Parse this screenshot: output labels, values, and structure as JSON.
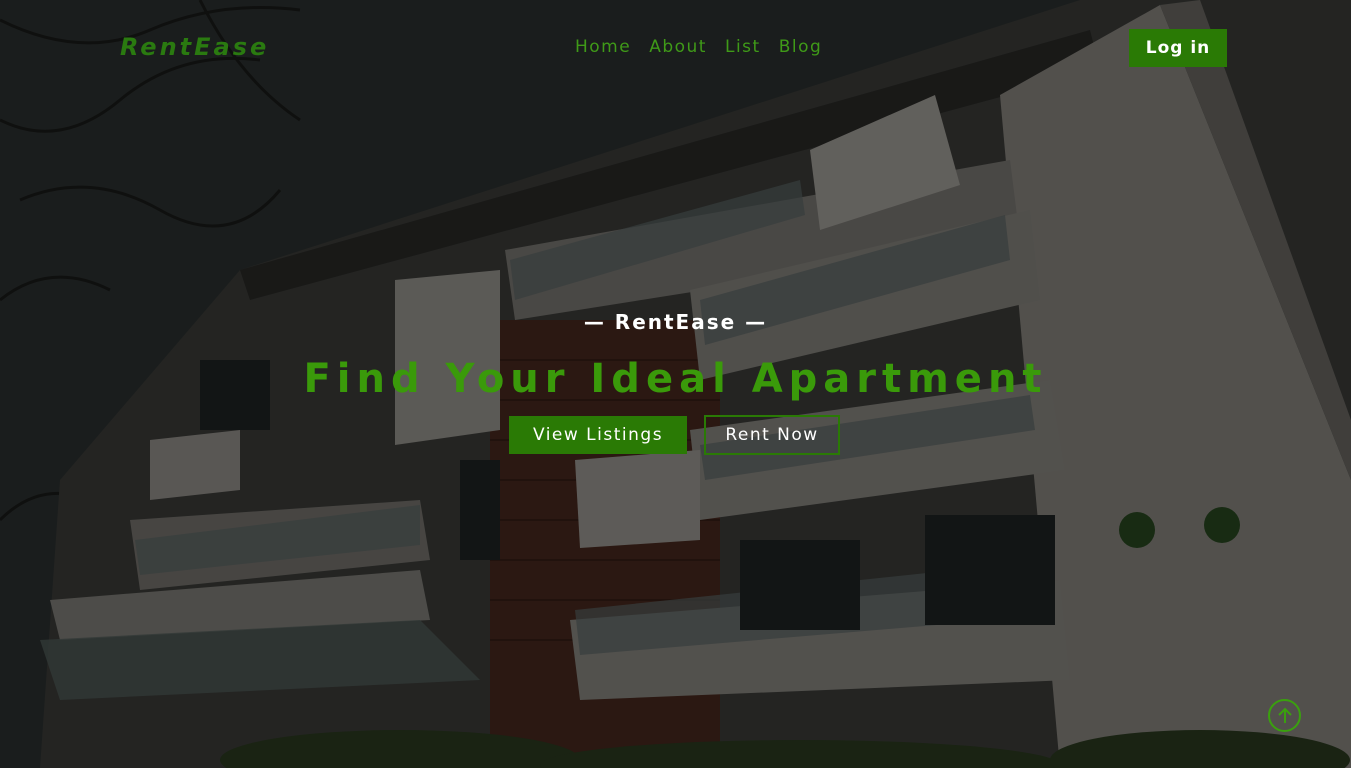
{
  "brand": {
    "logo": "RentEase"
  },
  "nav": {
    "links": [
      "Home",
      "About",
      "List",
      "Blog"
    ],
    "login_label": "Log in"
  },
  "hero": {
    "eyebrow": "— RentEase —",
    "headline": "Find Your Ideal Apartment",
    "primary_button": "View Listings",
    "secondary_button": "Rent Now",
    "background_image": "apartment-building-photo"
  },
  "icons": {
    "scroll_top": "arrow-up-circle-icon"
  },
  "colors": {
    "accent": "#2a7a05",
    "accent_text": "#3a9a0a",
    "text_light": "#ffffff"
  }
}
